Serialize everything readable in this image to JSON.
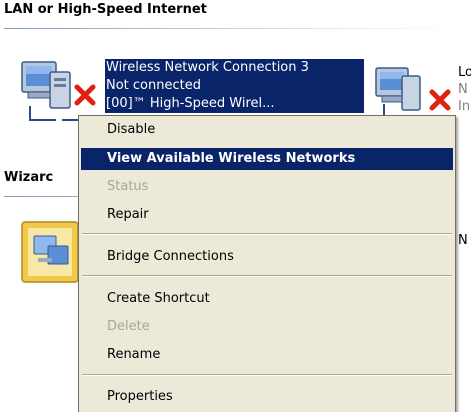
{
  "lan_group": {
    "header": "LAN or High-Speed Internet"
  },
  "wireless_connection": {
    "name": "Wireless Network Connection 3",
    "status": "Not connected",
    "device_partial": "[00]™ High-Speed Wirel..."
  },
  "local_connection": {
    "name_partial": "Lo",
    "status_partial": "N",
    "device_partial": "In"
  },
  "wizard_group": {
    "header_partial": "Wizarc",
    "item_partial": "N"
  },
  "context_menu": {
    "disable": "Disable",
    "view_wireless": "View Available Wireless Networks",
    "status": "Status",
    "repair": "Repair",
    "bridge": "Bridge Connections",
    "create_shortcut": "Create Shortcut",
    "delete": "Delete",
    "rename": "Rename",
    "properties": "Properties"
  },
  "colors": {
    "selection": "#0a246a",
    "menu_bg": "#ece9d8",
    "error_x": "#e02010",
    "disabled_text": "#a7a69c"
  },
  "icons": {
    "network_connection": "network-computer-icon",
    "disconnected": "red-x-icon",
    "wizard": "network-wizard-icon"
  }
}
